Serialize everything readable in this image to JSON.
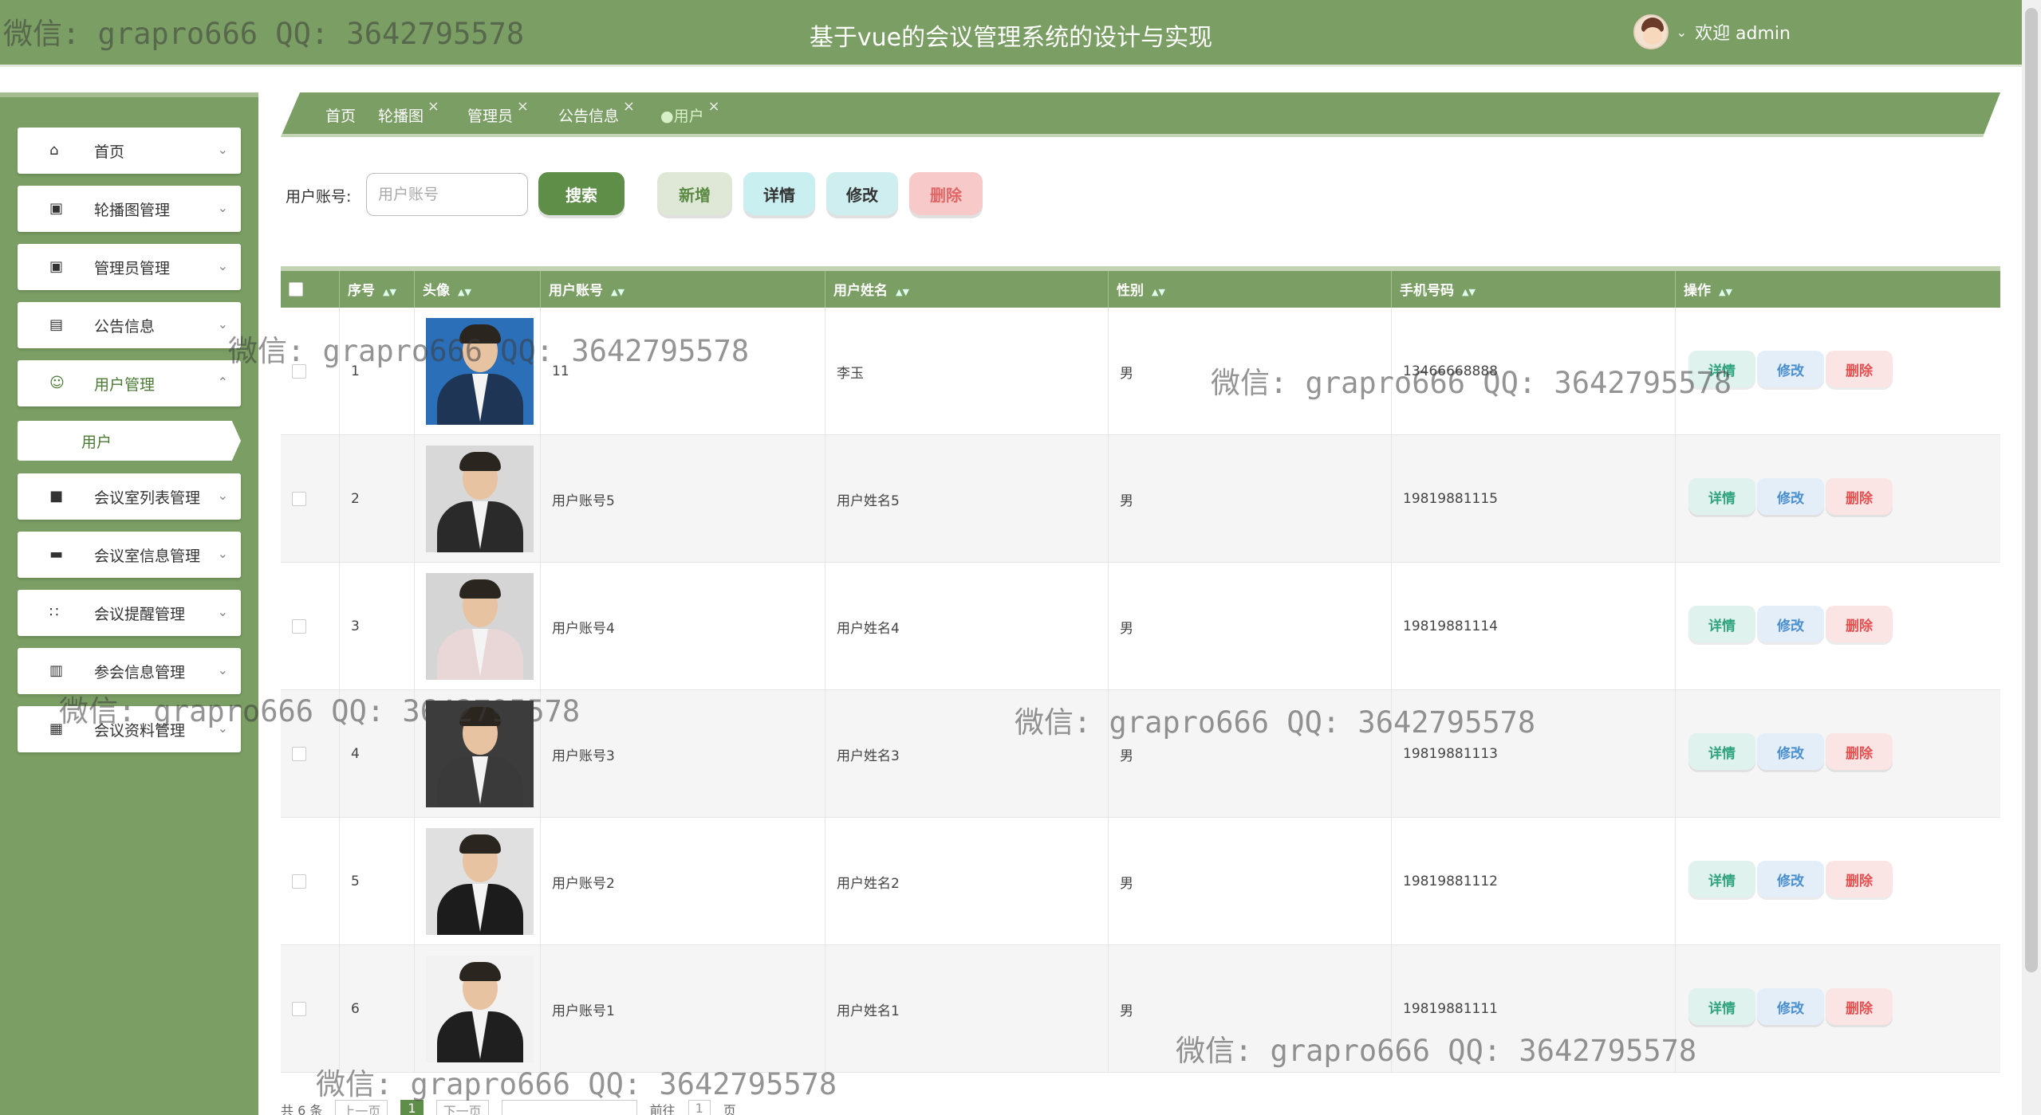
{
  "header": {
    "title": "基于vue的会议管理系统的设计与实现",
    "welcome": "欢迎 admin"
  },
  "sidebar": {
    "items": [
      {
        "label": "首页",
        "icon": "home-icon"
      },
      {
        "label": "轮播图管理",
        "icon": "briefcase-icon"
      },
      {
        "label": "管理员管理",
        "icon": "briefcase-icon"
      },
      {
        "label": "公告信息",
        "icon": "folder-icon"
      },
      {
        "label": "用户管理",
        "icon": "user-icon"
      },
      {
        "label": "会议室列表管理",
        "icon": "box-icon"
      },
      {
        "label": "会议室信息管理",
        "icon": "ticket-icon"
      },
      {
        "label": "会议提醒管理",
        "icon": "grid-icon"
      },
      {
        "label": "参会信息管理",
        "icon": "folder-icon"
      },
      {
        "label": "会议资料管理",
        "icon": "wallet-icon"
      }
    ],
    "sub_item": "用户"
  },
  "tabs": [
    "首页",
    "轮播图",
    "管理员",
    "公告信息",
    "●用户"
  ],
  "search": {
    "label": "用户账号:",
    "placeholder": "用户账号",
    "search_btn": "搜索",
    "add_btn": "新增",
    "detail_btn": "详情",
    "edit_btn": "修改",
    "delete_btn": "删除"
  },
  "table": {
    "headers": [
      "序号",
      "头像",
      "用户账号",
      "用户姓名",
      "性别",
      "手机号码",
      "操作"
    ],
    "rows": [
      {
        "index": "1",
        "account": "11",
        "name": "李玉",
        "gender": "男",
        "phone": "13466668888"
      },
      {
        "index": "2",
        "account": "用户账号5",
        "name": "用户姓名5",
        "gender": "男",
        "phone": "19819881115"
      },
      {
        "index": "3",
        "account": "用户账号4",
        "name": "用户姓名4",
        "gender": "男",
        "phone": "19819881114"
      },
      {
        "index": "4",
        "account": "用户账号3",
        "name": "用户姓名3",
        "gender": "男",
        "phone": "19819881113"
      },
      {
        "index": "5",
        "account": "用户账号2",
        "name": "用户姓名2",
        "gender": "男",
        "phone": "19819881112"
      },
      {
        "index": "6",
        "account": "用户账号1",
        "name": "用户姓名1",
        "gender": "男",
        "phone": "19819881111"
      }
    ],
    "actions": {
      "detail": "详情",
      "edit": "修改",
      "delete": "删除"
    }
  },
  "pagination": {
    "total": "共 6 条",
    "prev": "上一页",
    "current": "1",
    "next": "下一页",
    "goto": "前往",
    "page_input": "1",
    "page_unit": "页"
  },
  "watermark": "微信: grapro666 QQ: 3642795578",
  "colors": {
    "primary": "#7a9e63",
    "accent_green": "#5f8e48",
    "delete_red": "#e35151",
    "edit_blue": "#4a8fd0"
  }
}
